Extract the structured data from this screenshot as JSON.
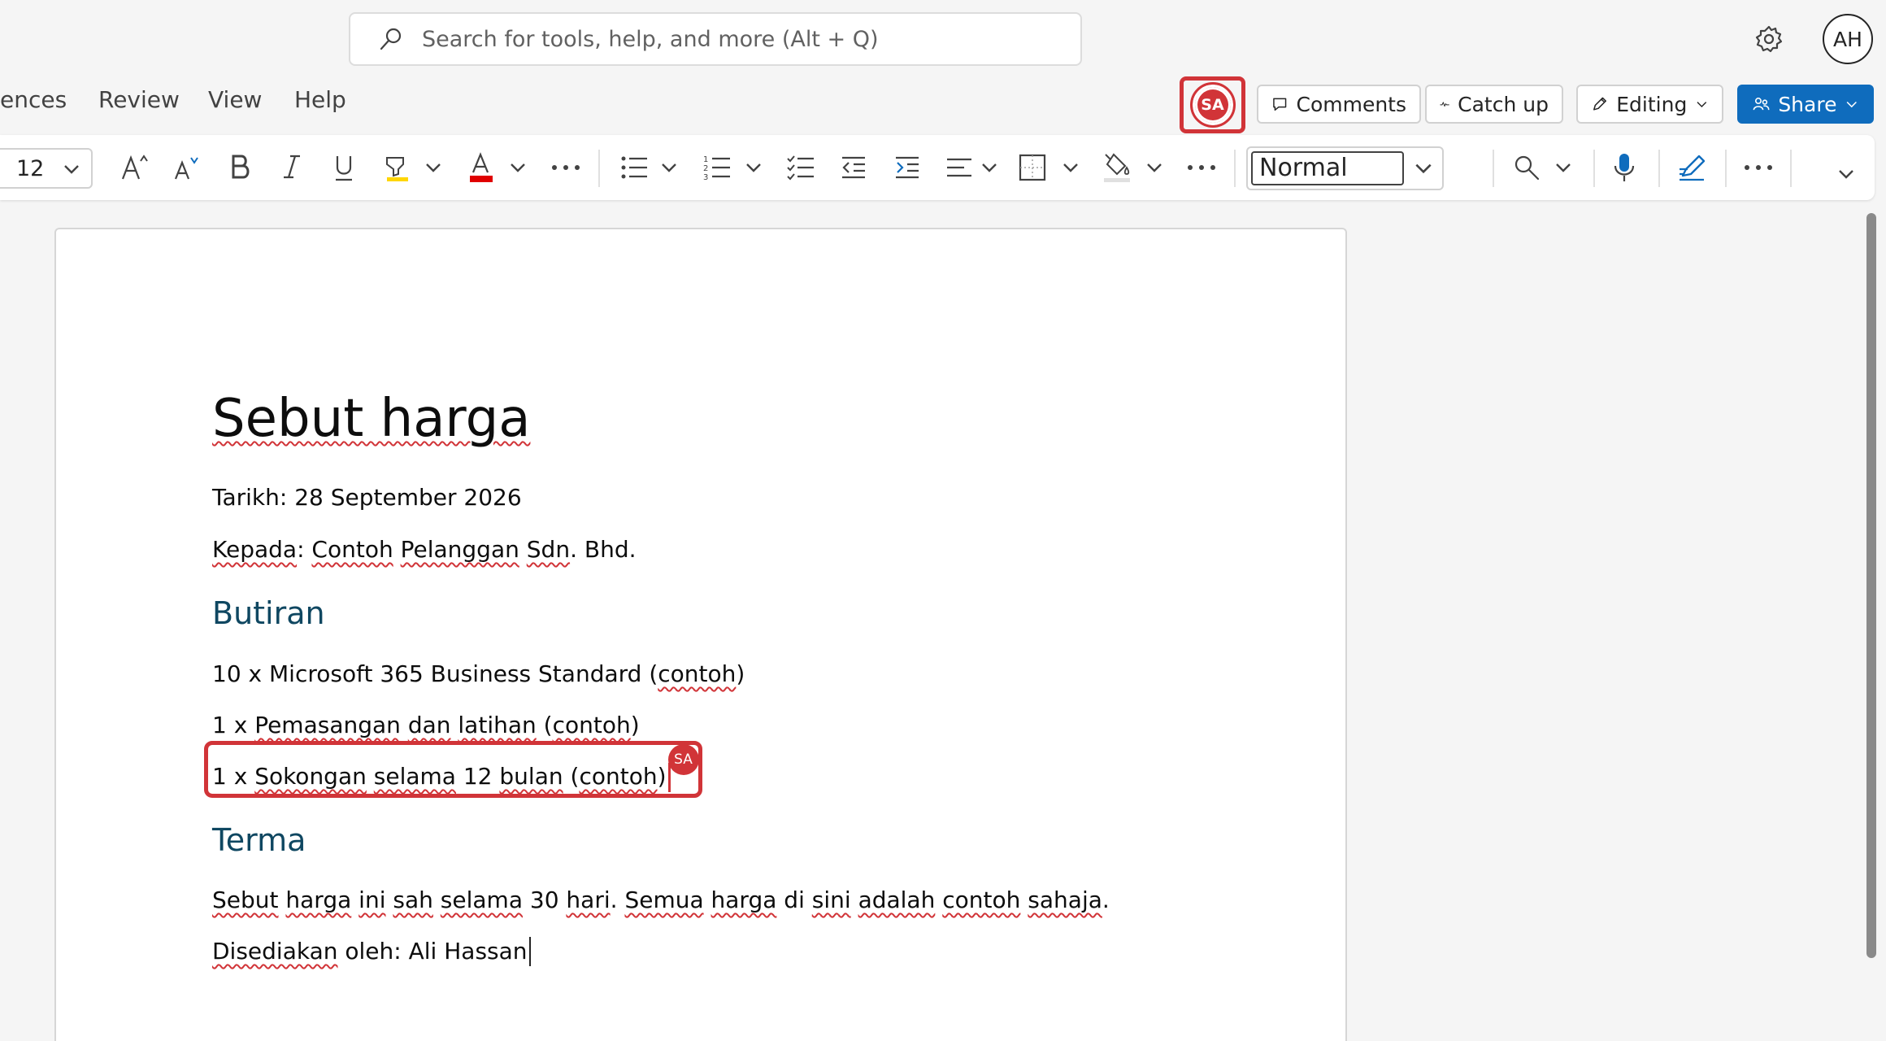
{
  "search": {
    "placeholder": "Search for tools, help, and more (Alt + Q)"
  },
  "user": {
    "initials": "AH"
  },
  "ribbon": {
    "tabs": [
      "ences",
      "Review",
      "View",
      "Help"
    ]
  },
  "collaborator": {
    "initials": "SA",
    "color": "#d13438"
  },
  "buttons": {
    "comments": "Comments",
    "catch_up": "Catch up",
    "editing": "Editing",
    "share": "Share"
  },
  "toolbar": {
    "font_size": "12",
    "style": "Normal"
  },
  "document": {
    "title": "Sebut harga",
    "date_line": "Tarikh: 28 September 2026",
    "to_line": {
      "parts": [
        "Kepada",
        ": ",
        "Contoh",
        " ",
        "Pelanggan",
        " ",
        "Sdn",
        ". Bhd."
      ]
    },
    "heading_items": "Butiran",
    "item1": {
      "prefix": "10 x Microsoft 365 Business Standard (",
      "sq": "contoh",
      "suffix": ")"
    },
    "item2": {
      "a": "1 x ",
      "b": "Pemasangan",
      "c": " ",
      "d": "dan",
      "e": " ",
      "f": "latihan",
      "g": " (",
      "h": "contoh",
      "i": ")"
    },
    "item3": {
      "a": "1 x ",
      "b": "Sokongan",
      "c": " ",
      "d": "selama",
      "e": " 12 ",
      "f": "bulan",
      "g": " (",
      "h": "contoh",
      "i": ")"
    },
    "heading_terms": "Terma",
    "terms": {
      "a": "Sebut",
      "b": " ",
      "c": "harga",
      "d": " ",
      "e": "ini",
      "f": " ",
      "g": "sah",
      "h": " ",
      "i": "selama",
      "j": " 30 ",
      "k": "hari",
      "l": ". ",
      "m": "Semua",
      "n": " ",
      "o": "harga",
      "p": " di ",
      "q": "sini",
      "r": " ",
      "s": "adalah",
      "t": " ",
      "u": "contoh",
      "v": " ",
      "w": "sahaja",
      "x": "."
    },
    "prepared": {
      "a": "Disediakan",
      "b": " oleh: Ali Hassan"
    },
    "cursor_user": "SA"
  }
}
